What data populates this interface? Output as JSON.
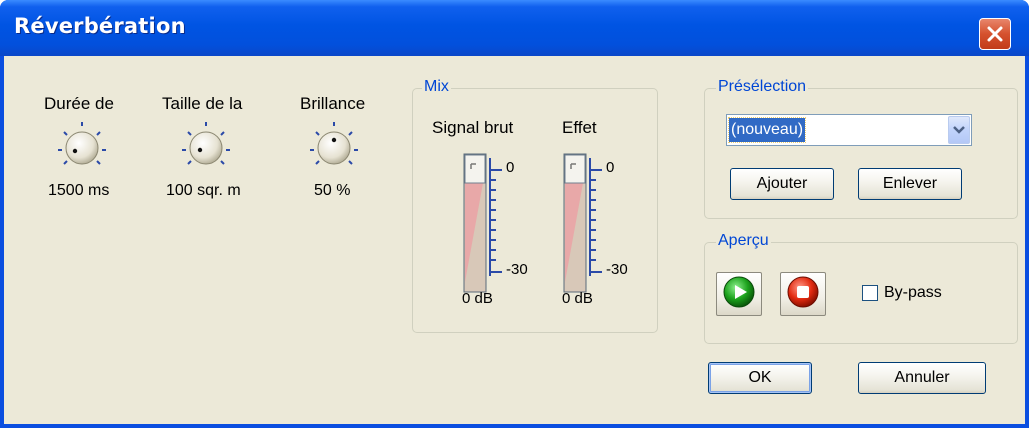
{
  "window": {
    "title": "Réverbération",
    "close_icon": "close-icon",
    "colors": {
      "titlebar": "#0054e3",
      "client": "#ece9d8",
      "group_title": "#0046d5",
      "close": "#d5512e"
    }
  },
  "knobs": [
    {
      "label": "Durée de",
      "value": "1500 ms",
      "level": 0.0
    },
    {
      "label": "Taille de la",
      "value": "100 sqr. m",
      "level": 0.0
    },
    {
      "label": "Brillance",
      "value": "50 %",
      "level": 0.5
    }
  ],
  "mix": {
    "title": "Mix",
    "channels": [
      {
        "label": "Signal brut",
        "top_mark": "0",
        "bottom_mark": "-30",
        "value": "0 dB",
        "level": 1.0
      },
      {
        "label": "Effet",
        "top_mark": "0",
        "bottom_mark": "-30",
        "value": "0 dB",
        "level": 1.0
      }
    ]
  },
  "preset": {
    "title": "Présélection",
    "selected": "(nouveau)",
    "add_label": "Ajouter",
    "remove_label": "Enlever"
  },
  "preview": {
    "title": "Aperçu",
    "play_icon": "play-icon",
    "stop_icon": "stop-icon",
    "bypass_label": "By-pass",
    "bypass_checked": false
  },
  "footer": {
    "ok_label": "OK",
    "cancel_label": "Annuler"
  }
}
